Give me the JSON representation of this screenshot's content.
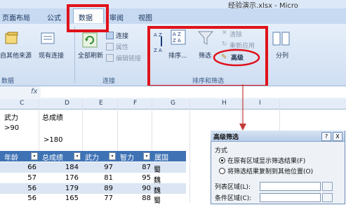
{
  "window": {
    "title": "经验演示.xlsx - Micro"
  },
  "tabs": [
    "页面布局",
    "公式",
    "数据",
    "审阅",
    "视图"
  ],
  "ribbon": {
    "get_external": "自其他来源",
    "existing_conn": "现有连接",
    "refresh_all": "全部刷新",
    "connections": "连接",
    "properties": "属性",
    "edit_links": "编辑链接",
    "sort": "排序...",
    "filter": "筛选",
    "clear": "清除",
    "reapply": "重新应用",
    "advanced": "高级",
    "split": "分列",
    "sort_az": "A Z",
    "sort_za": "Z A",
    "groups": {
      "external": "数据",
      "connections": "连接",
      "sort_filter": "排序和筛选"
    }
  },
  "formula_bar": {
    "fx": "fx"
  },
  "columns": [
    "C",
    "D",
    "E",
    "F",
    "G",
    "H",
    "I"
  ],
  "criteria": {
    "h1": "武力",
    "h2": "总成绩",
    "v1": ">90",
    "v2": ">180"
  },
  "table": {
    "headers": [
      "年龄",
      "总成绩",
      "武力",
      "智力",
      "属国"
    ],
    "rows": [
      {
        "age": "66",
        "total": "184",
        "force": "97",
        "intel": "87",
        "state": "蜀"
      },
      {
        "age": "57",
        "total": "176",
        "force": "81",
        "intel": "95",
        "state": "魏"
      },
      {
        "age": "56",
        "total": "179",
        "force": "89",
        "intel": "90",
        "state": "魏"
      },
      {
        "age": "56",
        "total": "165",
        "force": "77",
        "intel": "88",
        "state": "蜀"
      }
    ]
  },
  "dialog": {
    "title": "高级筛选",
    "help": "?",
    "close": "X",
    "section": "方式",
    "option1": "在原有区域显示筛选结果(F)",
    "option2": "将筛选结果复制到其他位置(O)",
    "list_range": "列表区域(L):",
    "criteria_range": "条件区域(C):"
  },
  "colors": {
    "accent_red": "#e0121a",
    "header_blue": "#3e72b5"
  }
}
